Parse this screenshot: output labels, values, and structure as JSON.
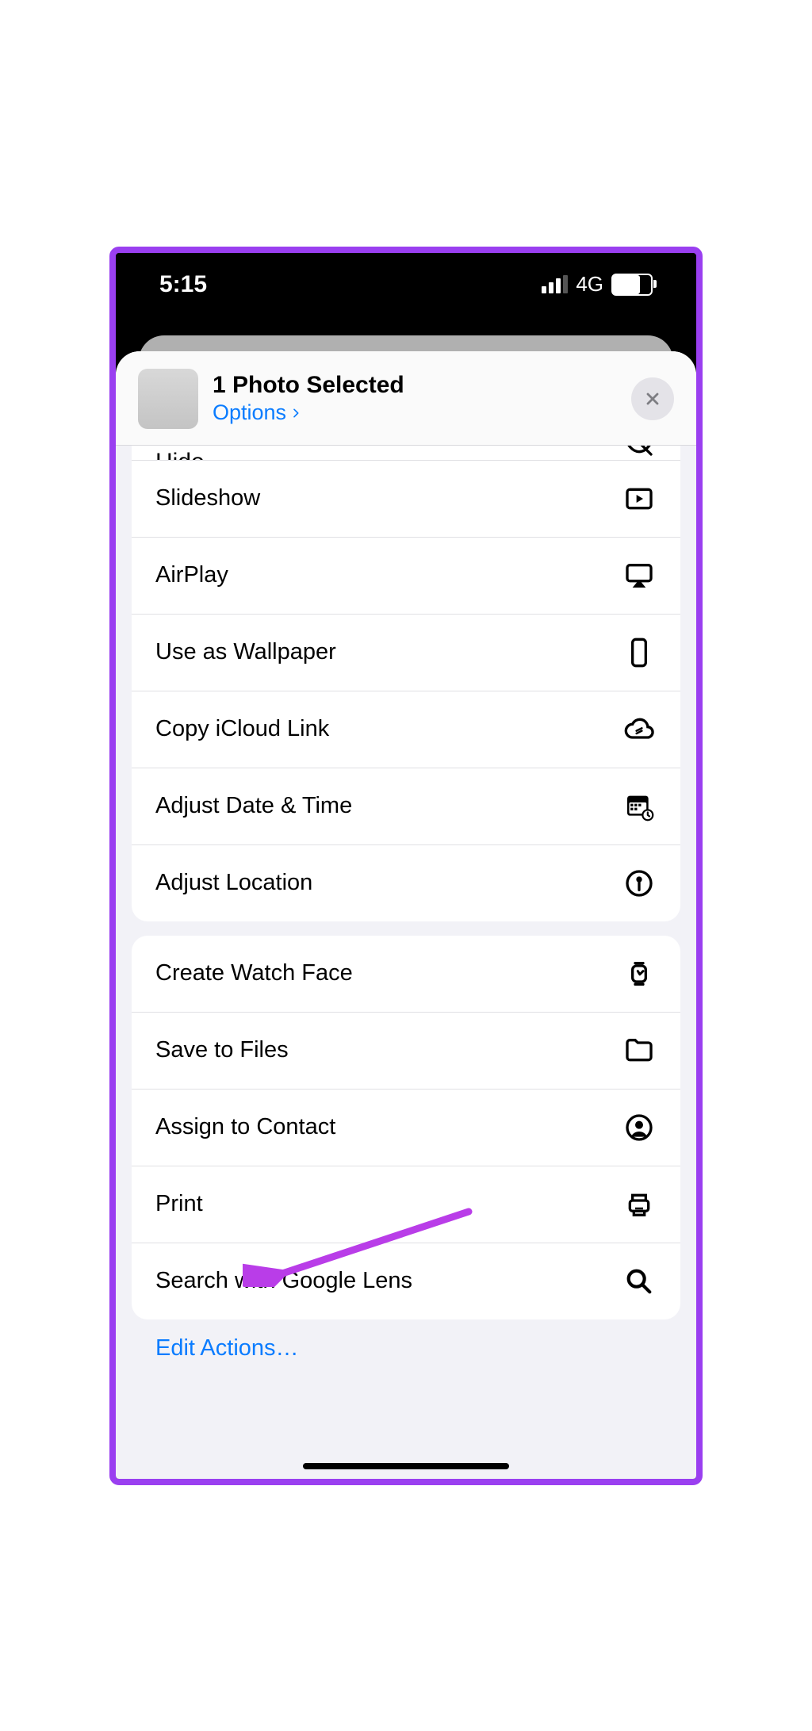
{
  "status": {
    "time": "5:15",
    "network_label": "4G",
    "battery_pct": 70
  },
  "header": {
    "title": "1 Photo Selected",
    "options_label": "Options"
  },
  "actions_partial": {
    "label": "Hide"
  },
  "group1": [
    {
      "label": "Slideshow",
      "icon": "play-rect"
    },
    {
      "label": "AirPlay",
      "icon": "airplay"
    },
    {
      "label": "Use as Wallpaper",
      "icon": "phone"
    },
    {
      "label": "Copy iCloud Link",
      "icon": "cloud-link"
    },
    {
      "label": "Adjust Date & Time",
      "icon": "calendar-clock"
    },
    {
      "label": "Adjust Location",
      "icon": "pin"
    }
  ],
  "group2": [
    {
      "label": "Create Watch Face",
      "icon": "watch"
    },
    {
      "label": "Save to Files",
      "icon": "folder"
    },
    {
      "label": "Assign to Contact",
      "icon": "contact"
    },
    {
      "label": "Print",
      "icon": "printer"
    },
    {
      "label": "Search with Google Lens",
      "icon": "search"
    }
  ],
  "edit_actions_label": "Edit Actions…",
  "annotation": {
    "arrow_color": "#b93de8",
    "points_to": "Print"
  }
}
